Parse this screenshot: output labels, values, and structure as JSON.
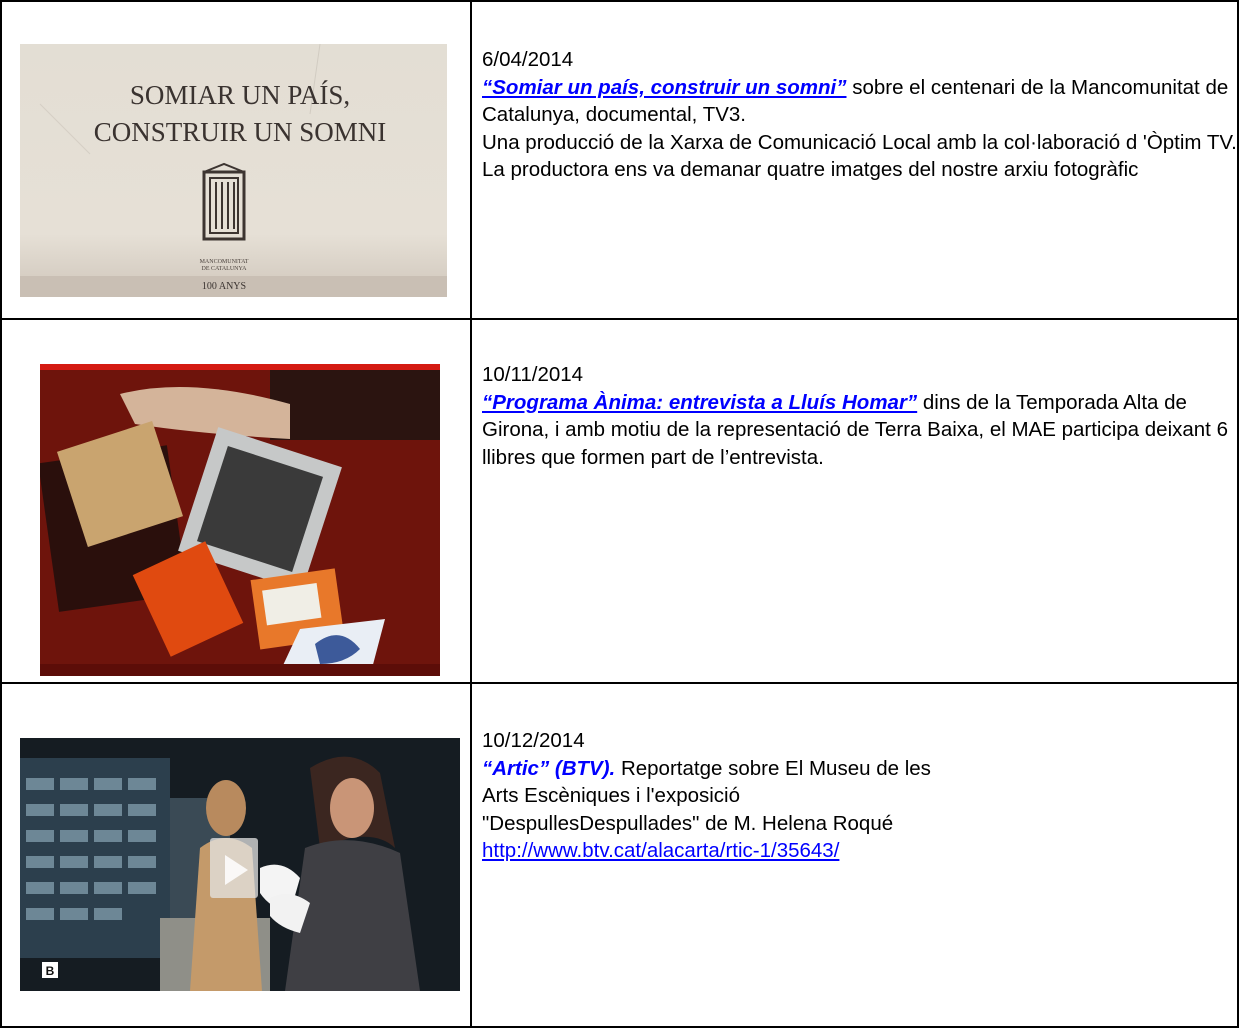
{
  "entries": [
    {
      "date": "6/04/2014",
      "title": "“Somiar un país, construir un somni”",
      "text_after_title": " sobre el centenari de la Mancomunitat de Catalunya, documental, TV3.",
      "text2": "Una producció de la Xarxa de Comunicació Local amb la col·laboració d 'Òptim TV.   La productora ens va demanar quatre imatges del nostre arxiu fotogràfic",
      "image": {
        "line1": "SOMIAR UN PAÍS,",
        "line2": "CONSTRUIR UN SOMNI",
        "caption1": "MANCOMUNITAT",
        "caption2": "DE CATALUNYA",
        "caption3": "100 ANYS"
      }
    },
    {
      "date": "10/11/2014",
      "title": "“Programa Ànima: entrevista a Lluís Homar”",
      "text_after_title": " dins de la Temporada Alta de Girona, i amb motiu de la representació de Terra Baixa, el MAE participa deixant 6 llibres que formen part de l’entrevista."
    },
    {
      "date": "10/12/2014",
      "title": "“Artic” (BTV).",
      "text_after_title": " Reportatge sobre El Museu de les Arts Escèniques i  l'exposició \"DespullesDespullades\" de M. Helena Roqué",
      "url": "http://www.btv.cat/alacarta/rtic-1/35643/",
      "image": {
        "badge": "B"
      }
    }
  ],
  "colors": {
    "link": "#0000ff",
    "border": "#000000"
  }
}
